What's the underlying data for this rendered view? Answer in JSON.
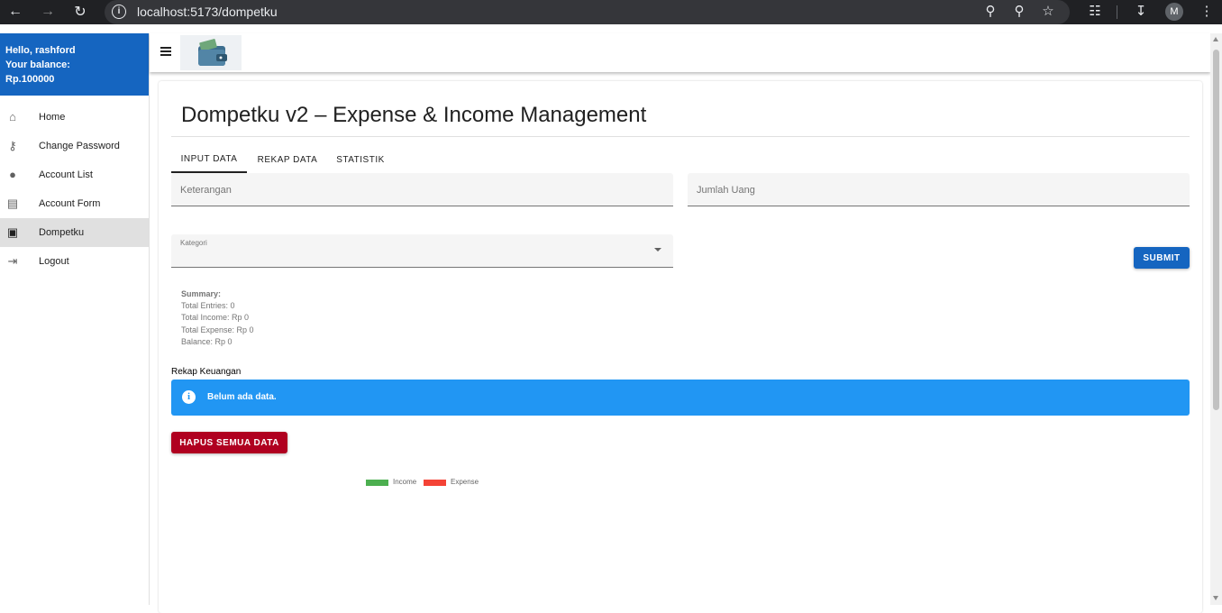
{
  "browser": {
    "url": "localhost:5173/dompetku",
    "profile_initial": "M"
  },
  "sidebar": {
    "greeting": "Hello, rashford",
    "balance_label": "Your balance:",
    "balance_value": "Rp.100000",
    "items": [
      {
        "label": "Home",
        "icon": "home-icon"
      },
      {
        "label": "Change Password",
        "icon": "key-icon"
      },
      {
        "label": "Account List",
        "icon": "person-icon"
      },
      {
        "label": "Account Form",
        "icon": "form-icon"
      },
      {
        "label": "Dompetku",
        "icon": "wallet-icon",
        "active": true
      },
      {
        "label": "Logout",
        "icon": "logout-icon"
      }
    ]
  },
  "main": {
    "title": "Dompetku v2 – Expense & Income Management",
    "tabs": [
      {
        "label": "INPUT DATA",
        "active": true
      },
      {
        "label": "REKAP DATA"
      },
      {
        "label": "STATISTIK"
      }
    ],
    "form": {
      "keterangan_label": "Keterangan",
      "jumlah_label": "Jumlah Uang",
      "kategori_label": "Kategori",
      "submit_label": "SUBMIT"
    },
    "summary": {
      "title": "Summary:",
      "total_entries": "Total Entries: 0",
      "total_income": "Total Income: Rp 0",
      "total_expense": "Total Expense: Rp 0",
      "balance": "Balance: Rp 0"
    },
    "rekap": {
      "title": "Rekap Keuangan",
      "empty_message": "Belum ada data.",
      "delete_label": "HAPUS SEMUA DATA"
    },
    "legend": [
      {
        "label": "Income",
        "color": "#4caf50"
      },
      {
        "label": "Expense",
        "color": "#f44336"
      }
    ]
  },
  "colors": {
    "primary": "#1565c0",
    "info": "#2196f3",
    "danger": "#b00020"
  }
}
